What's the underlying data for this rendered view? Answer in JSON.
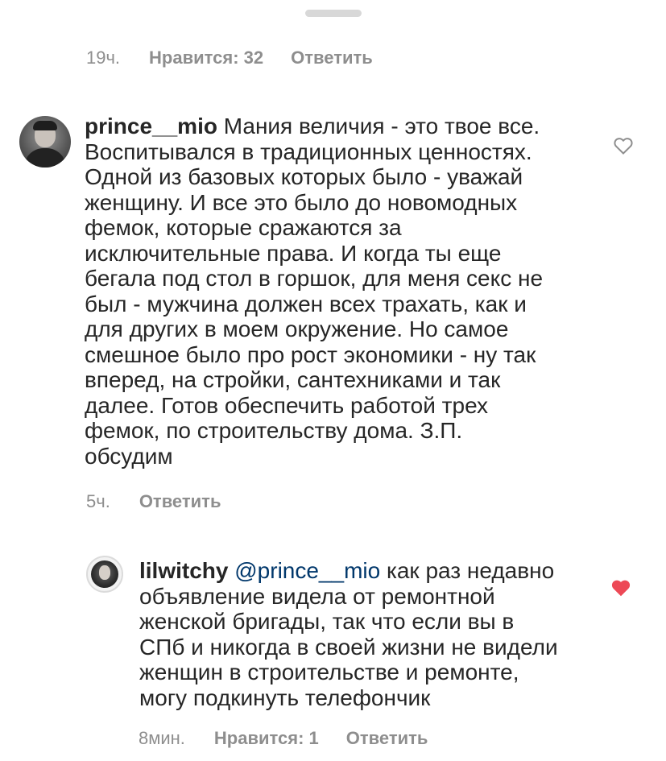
{
  "top_meta": {
    "time": "19ч.",
    "likes": "Нравится: 32",
    "reply": "Ответить"
  },
  "comment1": {
    "username": "prince__mio",
    "text": " Мания величия - это твое все.\nВоспитывался в традиционных ценностях.\nОдной из базовых которых было - уважай\nженщину. И все это было до новомодных\nфемок, которые сражаются за\nисключительные права. И когда ты еще\nбегала под стол в горшок, для меня секс не\nбыл - мужчина должен всех трахать, как и\nдля других в моем окружение. Но самое\nсмешное было про рост экономики - ну так\nвперед, на стройки, сантехниками и так\nдалее. Готов обеспечить работой трех\nфемок, по строительству дома. З.П.\nобсудим",
    "time": "5ч.",
    "reply": "Ответить",
    "like_icon": "heart-outline-icon",
    "like_color": "#8e8e8e"
  },
  "comment2": {
    "username": "lilwitchy",
    "mention": " @prince__mio",
    "text": " как раз недавно\nобъявление видела от ремонтной\nженской бригады, так что если вы в\nСПб и никогда в своей жизни не видели\nженщин в строительстве и ремонте,\nмогу подкинуть телефончик",
    "time": "8мин.",
    "likes": "Нравится: 1",
    "reply": "Ответить",
    "like_icon": "heart-filled-icon",
    "like_color": "#ed4956"
  }
}
